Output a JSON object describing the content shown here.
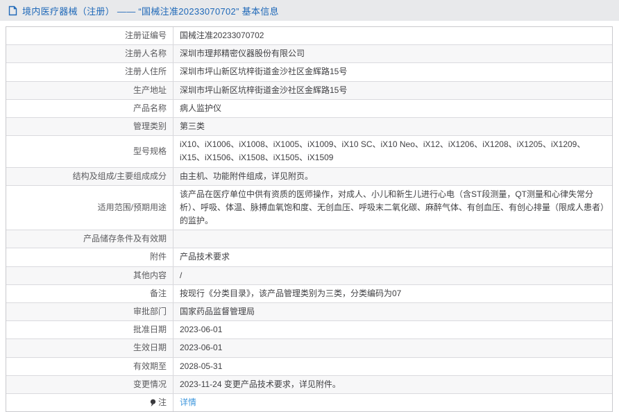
{
  "header": {
    "icon": "document-icon",
    "title": "境内医疗器械（注册） —— “国械注准20233070702” 基本信息"
  },
  "colors": {
    "topbar_bg": "#e8e9eb",
    "title_blue": "#1e68b8",
    "row_alt_bg": "#f7f7f8",
    "border": "#c9c9cd",
    "label_text": "#5b5b5e",
    "value_text": "#404043",
    "link_blue": "#3f97dd"
  },
  "table": {
    "rows": [
      {
        "label": "注册证编号",
        "value": "国械注准20233070702"
      },
      {
        "label": "注册人名称",
        "value": "深圳市理邦精密仪器股份有限公司"
      },
      {
        "label": "注册人住所",
        "value": "深圳市坪山新区坑梓街道金沙社区金辉路15号"
      },
      {
        "label": "生产地址",
        "value": "深圳市坪山新区坑梓街道金沙社区金辉路15号"
      },
      {
        "label": "产品名称",
        "value": "病人监护仪"
      },
      {
        "label": "管理类别",
        "value": "第三类"
      },
      {
        "label": "型号规格",
        "value": "iX10、iX1006、iX1008、iX1005、iX1009、iX10 SC、iX10 Neo、iX12、iX1206、iX1208、iX1205、iX1209、iX15、iX1506、iX1508、iX1505、iX1509"
      },
      {
        "label": "结构及组成/主要组成成分",
        "value": "由主机、功能附件组成，详见附页。"
      },
      {
        "label": "适用范围/预期用途",
        "value": "该产品在医疗单位中供有资质的医师操作，对成人、小儿和新生儿进行心电（含ST段测量，QT测量和心律失常分析）、呼吸、体温、脉搏血氧饱和度、无创血压、呼吸末二氧化碳、麻醉气体、有创血压、有创心排量（限成人患者）的监护。"
      },
      {
        "label": "产品储存条件及有效期",
        "value": ""
      },
      {
        "label": "附件",
        "value": "产品技术要求"
      },
      {
        "label": "其他内容",
        "value": "/"
      },
      {
        "label": "备注",
        "value": "按现行《分类目录》，该产品管理类别为三类，分类编码为07"
      },
      {
        "label": "审批部门",
        "value": "国家药品监督管理局"
      },
      {
        "label": "批准日期",
        "value": "2023-06-01"
      },
      {
        "label": "生效日期",
        "value": "2023-06-01"
      },
      {
        "label": "有效期至",
        "value": "2028-05-31"
      },
      {
        "label": "变更情况",
        "value": "2023-11-24 变更产品技术要求，详见附件。"
      },
      {
        "label": "注",
        "label_icon": "pin-icon",
        "value": "详情",
        "value_is_link": true
      }
    ]
  }
}
